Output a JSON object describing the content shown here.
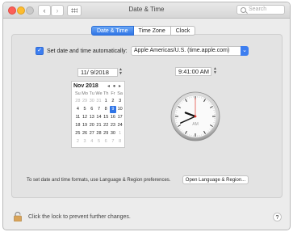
{
  "window": {
    "title": "Date & Time"
  },
  "search": {
    "placeholder": "Search"
  },
  "tabs": [
    {
      "label": "Date & Time",
      "active": true
    },
    {
      "label": "Time Zone",
      "active": false
    },
    {
      "label": "Clock",
      "active": false
    }
  ],
  "auto": {
    "label": "Set date and time automatically:",
    "server": "Apple Americas/U.S. (time.apple.com)",
    "checked": true
  },
  "date": {
    "value": "11/  9/2018"
  },
  "time": {
    "value": "9:41:00 AM"
  },
  "calendar": {
    "month": "Nov 2018",
    "weekdays": [
      "Su",
      "Mo",
      "Tu",
      "We",
      "Th",
      "Fr",
      "Sa"
    ],
    "weeks": [
      [
        {
          "d": "28",
          "m": true
        },
        {
          "d": "29",
          "m": true
        },
        {
          "d": "30",
          "m": true
        },
        {
          "d": "31",
          "m": true
        },
        {
          "d": "1"
        },
        {
          "d": "2"
        },
        {
          "d": "3"
        }
      ],
      [
        {
          "d": "4"
        },
        {
          "d": "5"
        },
        {
          "d": "6"
        },
        {
          "d": "7"
        },
        {
          "d": "8"
        },
        {
          "d": "9",
          "s": true
        },
        {
          "d": "10"
        }
      ],
      [
        {
          "d": "11"
        },
        {
          "d": "12"
        },
        {
          "d": "13"
        },
        {
          "d": "14"
        },
        {
          "d": "15"
        },
        {
          "d": "16"
        },
        {
          "d": "17"
        }
      ],
      [
        {
          "d": "18"
        },
        {
          "d": "19"
        },
        {
          "d": "20"
        },
        {
          "d": "21"
        },
        {
          "d": "22"
        },
        {
          "d": "23"
        },
        {
          "d": "24"
        }
      ],
      [
        {
          "d": "25"
        },
        {
          "d": "26"
        },
        {
          "d": "27"
        },
        {
          "d": "28"
        },
        {
          "d": "29"
        },
        {
          "d": "30"
        },
        {
          "d": "1",
          "m": true
        }
      ],
      [
        {
          "d": "2",
          "m": true
        },
        {
          "d": "3",
          "m": true
        },
        {
          "d": "4",
          "m": true
        },
        {
          "d": "5",
          "m": true
        },
        {
          "d": "6",
          "m": true
        },
        {
          "d": "7",
          "m": true
        },
        {
          "d": "8",
          "m": true
        }
      ]
    ],
    "nav": "◂ ● ▸"
  },
  "clock": {
    "ampm": "AM",
    "hour": 9,
    "minute": 41,
    "second": 0
  },
  "footer": {
    "formats_note": "To set date and time formats, use Language & Region preferences.",
    "open_button": "Open Language & Region...",
    "lock_text": "Click the lock to prevent further changes.",
    "help": "?"
  },
  "colors": {
    "accent": "#2f74e6",
    "second_hand": "#e0352b"
  }
}
